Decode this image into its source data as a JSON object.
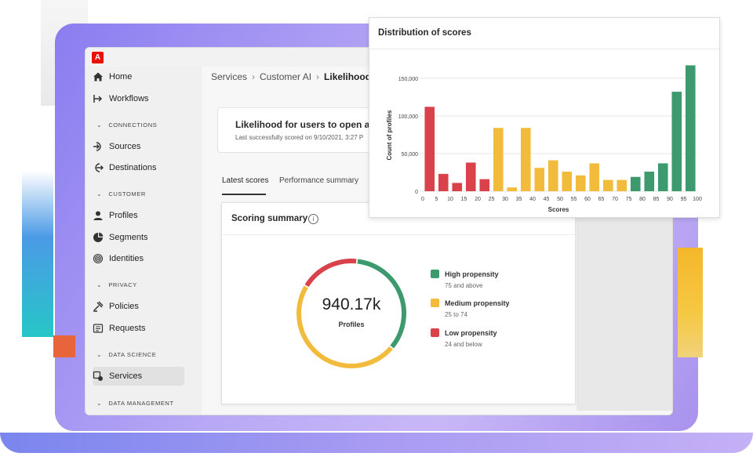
{
  "app": {
    "logo_letter": "A"
  },
  "sidebar": {
    "items": [
      {
        "label": "Home",
        "icon": "home-icon"
      },
      {
        "label": "Workflows",
        "icon": "workflows-icon"
      },
      {
        "label": "Sources",
        "icon": "sources-icon"
      },
      {
        "label": "Destinations",
        "icon": "destinations-icon"
      },
      {
        "label": "Profiles",
        "icon": "profiles-icon"
      },
      {
        "label": "Segments",
        "icon": "segments-icon"
      },
      {
        "label": "Identities",
        "icon": "identities-icon"
      },
      {
        "label": "Policies",
        "icon": "policies-icon"
      },
      {
        "label": "Requests",
        "icon": "requests-icon"
      },
      {
        "label": "Services",
        "icon": "services-icon",
        "selected": true
      }
    ],
    "sections": [
      "CONNECTIONS",
      "CUSTOMER",
      "PRIVACY",
      "DATA SCIENCE",
      "DATA MANAGEMENT"
    ]
  },
  "breadcrumb": {
    "items": [
      "Services",
      "Customer AI"
    ],
    "current": "Likelihood fo"
  },
  "model": {
    "title": "Likelihood for users to open an",
    "subtitle": "Last successfully scored on 9/10/2021, 3:27 P"
  },
  "tabs": [
    "Latest scores",
    "Performance summary"
  ],
  "summary": {
    "title": "Scoring summary",
    "total": "940.17k",
    "total_label": "Profiles",
    "segments": [
      {
        "name": "High propensity",
        "range": "75 and above",
        "color": "#3d9a6e",
        "fraction": 0.345
      },
      {
        "name": "Medium propensity",
        "range": "25 to 74",
        "color": "#f3bb3b",
        "fraction": 0.475
      },
      {
        "name": "Low propensity",
        "range": "24 and below",
        "color": "#d9424a",
        "fraction": 0.18
      }
    ]
  },
  "distribution": {
    "title": "Distribution of scores"
  },
  "chart_data": {
    "type": "bar",
    "title": "Distribution of scores",
    "xlabel": "Scores",
    "ylabel": "Count of profiles",
    "ylim": [
      0,
      150000
    ],
    "yticks": [
      0,
      50000,
      100000,
      150000
    ],
    "ytick_labels": [
      "0",
      "50,000",
      "100,000",
      "150,000"
    ],
    "categories": [
      "0",
      "5",
      "10",
      "15",
      "20",
      "25",
      "30",
      "35",
      "40",
      "45",
      "50",
      "55",
      "60",
      "65",
      "70",
      "75",
      "80",
      "85",
      "90",
      "95",
      "100"
    ],
    "values": [
      112000,
      23000,
      11000,
      38000,
      16000,
      84000,
      5000,
      84000,
      31000,
      41000,
      26000,
      21000,
      37000,
      15000,
      15000,
      19000,
      26000,
      37000,
      132000,
      167000
    ],
    "colors": {
      "low": "#d9424a",
      "medium": "#f3bb3b",
      "high": "#3d9a6e"
    },
    "bar_color_groups": [
      "low",
      "low",
      "low",
      "low",
      "low",
      "medium",
      "medium",
      "medium",
      "medium",
      "medium",
      "medium",
      "medium",
      "medium",
      "medium",
      "medium",
      "high",
      "high",
      "high",
      "high",
      "high"
    ],
    "grid": true,
    "legend": "none"
  }
}
